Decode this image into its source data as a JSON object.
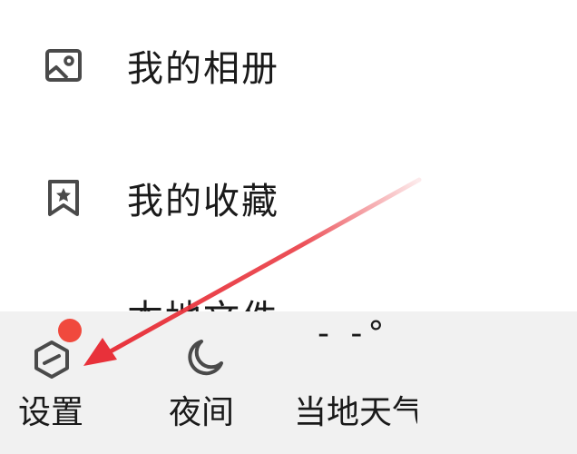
{
  "menu": {
    "items": [
      {
        "label": "我的相册",
        "icon": "photo-album-icon"
      },
      {
        "label": "我的收藏",
        "icon": "bookmark-star-icon"
      }
    ],
    "partial_label": "本地文件"
  },
  "bottom_bar": {
    "settings": {
      "label": "设置",
      "icon": "settings-hexagon-icon",
      "badge": true
    },
    "night": {
      "label": "夜间",
      "icon": "moon-icon"
    },
    "weather": {
      "label": "当地天气",
      "temperature": "- -°"
    }
  },
  "annotation": {
    "type": "red-arrow",
    "color": "#e8313a",
    "points_to": "settings"
  },
  "colors": {
    "background": "#ffffff",
    "bottom_bar_bg": "#f1f1f1",
    "text": "#1a1a1a",
    "icon": "#4a4a4a",
    "badge": "#f0493d"
  }
}
